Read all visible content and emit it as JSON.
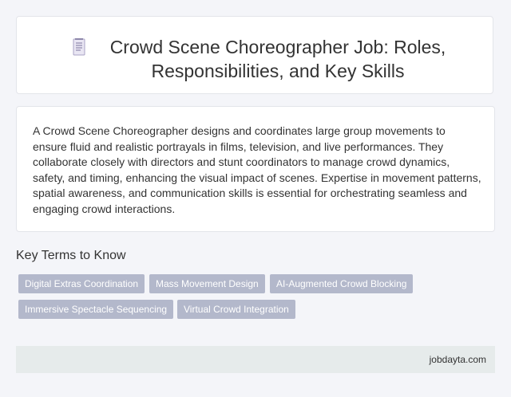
{
  "header": {
    "icon": "document-icon",
    "title": "Crowd Scene Choreographer Job: Roles, Responsibilities, and Key Skills"
  },
  "description": "A Crowd Scene Choreographer designs and coordinates large group movements to ensure fluid and realistic portrayals in films, television, and live performances. They collaborate closely with directors and stunt coordinators to manage crowd dynamics, safety, and timing, enhancing the visual impact of scenes. Expertise in movement patterns, spatial awareness, and communication skills is essential for orchestrating seamless and engaging crowd interactions.",
  "key_terms": {
    "heading": "Key Terms to Know",
    "tags": [
      "Digital Extras Coordination",
      "Mass Movement Design",
      "AI-Augmented Crowd Blocking",
      "Immersive Spectacle Sequencing",
      "Virtual Crowd Integration"
    ]
  },
  "footer": {
    "site": "jobdayta.com"
  },
  "colors": {
    "tag_background": "#b3b8cb",
    "footer_background": "#e6ebeb",
    "page_background": "#f4f5f9"
  }
}
